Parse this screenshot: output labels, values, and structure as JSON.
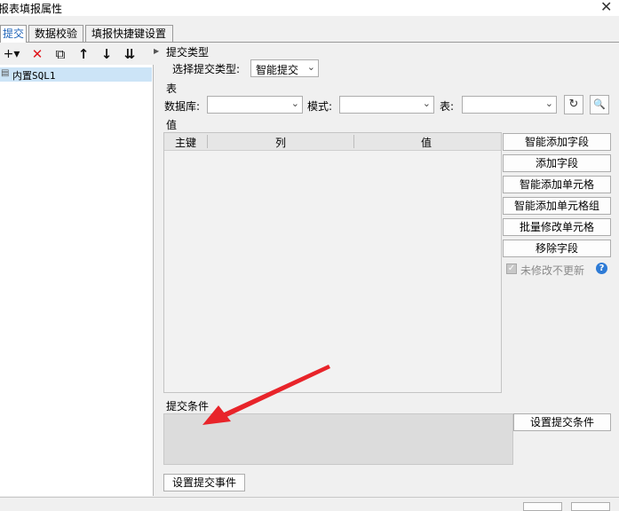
{
  "window": {
    "title": "报表填报属性",
    "close_glyph": "✕"
  },
  "tabs": [
    {
      "label": "提交",
      "active": true
    },
    {
      "label": "数据校验",
      "active": false
    },
    {
      "label": "填报快捷键设置",
      "active": false
    }
  ],
  "left": {
    "toolbar": [
      {
        "name": "add-icon",
        "glyph": "+▾"
      },
      {
        "name": "delete-icon",
        "glyph": "✕",
        "color": "#e0141b"
      },
      {
        "name": "copy-icon",
        "glyph": "⧉"
      },
      {
        "name": "move-up-icon",
        "glyph": "↑"
      },
      {
        "name": "move-down-icon",
        "glyph": "↓"
      },
      {
        "name": "sort-icon",
        "glyph": "⇊"
      }
    ],
    "tree_items": [
      {
        "label": "内置SQL1",
        "selected": true
      }
    ]
  },
  "submit_type": {
    "section": "提交类型",
    "label": "选择提交类型:",
    "value": "智能提交"
  },
  "table_section": {
    "section": "表",
    "database_label": "数据库:",
    "schema_label": "模式:",
    "table_label": "表:",
    "refresh_glyph": "↻",
    "preview_glyph": "🔍"
  },
  "values": {
    "section": "值",
    "columns": [
      "主键",
      "列",
      "值"
    ],
    "buttons": [
      "智能添加字段",
      "添加字段",
      "智能添加单元格",
      "智能添加单元格组",
      "批量修改单元格",
      "移除字段"
    ],
    "checkbox_label": "未修改不更新",
    "checkbox_checked": true,
    "help_glyph": "?"
  },
  "condition": {
    "section": "提交条件",
    "button": "设置提交条件"
  },
  "event_button": "设置提交事件",
  "colors": {
    "accent": "#1e63b8",
    "annotation_arrow": "#e8242a",
    "selection": "#cce4f7"
  }
}
